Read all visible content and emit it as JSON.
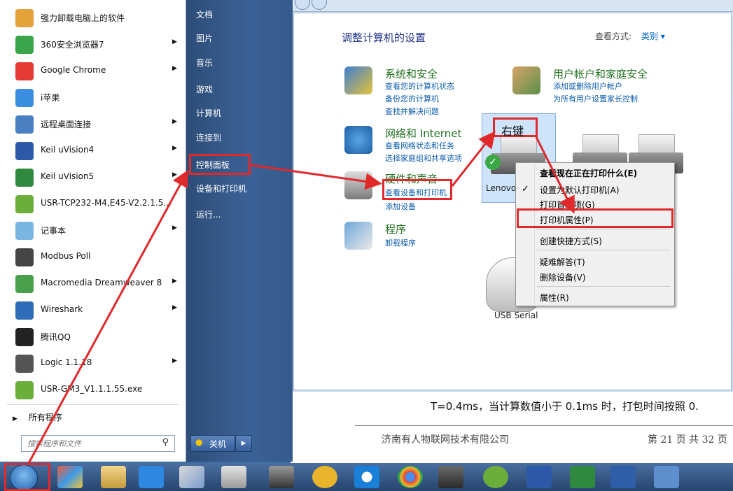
{
  "start_menu": {
    "programs": [
      {
        "name": "强力卸载电脑上的软件",
        "arrow": false,
        "color": "#e3a33a"
      },
      {
        "name": "360安全浏览器7",
        "arrow": true,
        "color": "#3aa54a"
      },
      {
        "name": "Google Chrome",
        "arrow": true,
        "color": "#e53935"
      },
      {
        "name": "i苹果",
        "arrow": false,
        "color": "#3c8ee0"
      },
      {
        "name": "远程桌面连接",
        "arrow": true,
        "color": "#4a7fc1"
      },
      {
        "name": "Keil uVision4",
        "arrow": true,
        "color": "#2c59a8"
      },
      {
        "name": "Keil uVision5",
        "arrow": true,
        "color": "#2f8a3f"
      },
      {
        "name": "USR-TCP232-M4,E45-V2.2.1.5...",
        "arrow": false,
        "color": "#6cae3c"
      },
      {
        "name": "记事本",
        "arrow": true,
        "color": "#7bb6e2"
      },
      {
        "name": "Modbus Poll",
        "arrow": false,
        "color": "#444444"
      },
      {
        "name": "Macromedia Dreamweaver 8",
        "arrow": true,
        "color": "#4aa04a"
      },
      {
        "name": "Wireshark",
        "arrow": true,
        "color": "#2e6db8"
      },
      {
        "name": "腾讯QQ",
        "arrow": false,
        "color": "#222222"
      },
      {
        "name": "Logic 1.1.18",
        "arrow": true,
        "color": "#555555"
      },
      {
        "name": "USR-GM3_V1.1.1.55.exe",
        "arrow": false,
        "color": "#6cae3c"
      }
    ],
    "all_programs": "所有程序",
    "search_placeholder": "搜索程序和文件",
    "right_items": [
      "文档",
      "图片",
      "音乐",
      "游戏",
      "计算机",
      "连接到",
      "控制面板",
      "设备和打印机",
      "运行..."
    ],
    "shutdown": "关机"
  },
  "control_panel": {
    "title": "调整计算机的设置",
    "view_label": "查看方式:",
    "view_value": "类别 ▾",
    "categories": [
      {
        "title": "系统和安全",
        "links": [
          "查看您的计算机状态",
          "备份您的计算机",
          "查找并解决问题"
        ]
      },
      {
        "title": "网络和 Internet",
        "links": [
          "查看网络状态和任务",
          "选择家庭组和共享选项"
        ]
      },
      {
        "title": "硬件和声音",
        "links": [
          "查看设备和打印机",
          "添加设备"
        ]
      },
      {
        "title": "程序",
        "links": [
          "卸载程序"
        ]
      },
      {
        "title": "用户帐户和家庭安全",
        "links": [
          "添加或删除用户帐户",
          "为所有用户设置家长控制"
        ]
      }
    ]
  },
  "devices": {
    "printer_label": "Lenovo",
    "usb_label": "USB Serial",
    "annotation": "右键"
  },
  "context_menu": {
    "items": [
      "查看现在正在打印什么(E)",
      "设置为默认打印机(A)",
      "打印首选项(G)",
      "打印机属性(P)",
      "创建快捷方式(S)",
      "疑难解答(T)",
      "删除设备(V)",
      "属性(R)"
    ]
  },
  "document": {
    "line1": "T=0.4ms，当计算数值小于 0.1ms 时，打包时间按照 0.",
    "company": "济南有人物联网技术有限公司",
    "page": "第 21 页 共 32 页"
  },
  "colors": {
    "annotation_red": "#e0292b",
    "link_blue": "#0b5ca8",
    "category_green": "#1f6f1f"
  }
}
